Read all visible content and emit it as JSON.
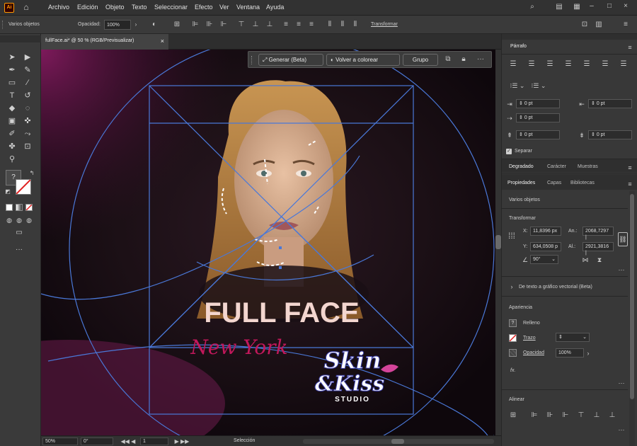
{
  "app": {
    "logo": "Ai",
    "home_icon": "home-icon"
  },
  "menu": [
    "Archivo",
    "Edición",
    "Objeto",
    "Texto",
    "Seleccionar",
    "Efecto",
    "Ver",
    "Ventana",
    "Ayuda"
  ],
  "control": {
    "selection_label": "Varios objetos",
    "opacity_label": "Opacidad:",
    "opacity_value": "100%",
    "transform_label": "Transformar"
  },
  "document": {
    "tab_title": "fullFace.ai* @ 50 % (RGB/Previsualizar)",
    "close": "×"
  },
  "context_bar": {
    "generate": "Generar (Beta)",
    "recolor": "Volver a colorear",
    "group": "Grupo",
    "more": "···"
  },
  "artwork": {
    "headline": "FULL FACE",
    "script": "New York",
    "logo_line1": "Skin",
    "logo_line2": "&Kiss",
    "logo_line3": "STUDIO",
    "colors": {
      "headline": "#f3d6cf",
      "script": "#c2185b",
      "logo": "#ffffff",
      "guide": "#4a78d8",
      "bg": "#1a0f18"
    }
  },
  "parrafo": {
    "title": "Párrafo",
    "indent_left": "0 pt",
    "indent_right": "0 pt",
    "first_line": "0 pt",
    "space_before": "0 pt",
    "space_after": "0 pt",
    "hyphen_label": "Separar"
  },
  "tabs_mid": [
    "Degradado",
    "Carácter",
    "Muestras"
  ],
  "tabs_props": [
    "Propiedades",
    "Capas",
    "Bibliotecas"
  ],
  "properties": {
    "selection": "Varios objetos",
    "transform_title": "Transformar",
    "x_label": "X:",
    "x_value": "11,8396 px",
    "y_label": "Y:",
    "y_value": "634,0508 p",
    "w_label": "An.:",
    "w_value": "2068,7297 |",
    "h_label": "Al.:",
    "h_value": "2921,3816 |",
    "angle_value": "90°",
    "text_to_vector": "De texto a gráfico vectorial (Beta)",
    "appearance_title": "Apariencia",
    "fill_label": "Relleno",
    "stroke_label": "Trazo",
    "opacity_label": "Opacidad",
    "opacity_value": "100%",
    "fx_label": "fx.",
    "align_title": "Alinear"
  },
  "status": {
    "zoom": "50%",
    "rotation": "0°",
    "artboard": "1",
    "tool": "Selección"
  }
}
